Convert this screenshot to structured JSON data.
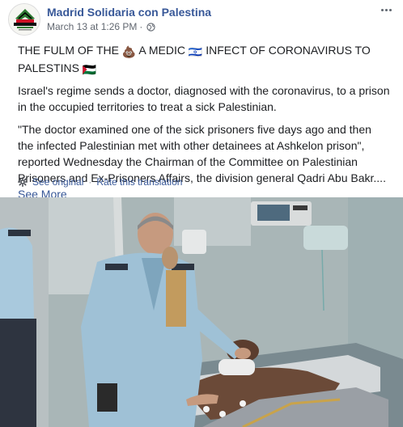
{
  "post": {
    "page_name": "Madrid Solidaria con Palestina",
    "timestamp": "March 13 at 1:26 PM",
    "separator": "·",
    "avatar_logo_text": "MADRID SOLIDARIA CON PALESTINA",
    "headline_part1": "THE FULM OF THE ",
    "headline_emoji1": "💩",
    "headline_part2": " A MEDIC ",
    "headline_emoji2": "🇮🇱",
    "headline_part3": " INFECT OF CORONAVIRUS TO PALESTINS ",
    "headline_emoji3": "🇵🇸",
    "paragraph1": "Israel's regime sends a doctor, diagnosed with the coronavirus, to a prison in the occupied territories to treat a sick Palestinian.",
    "paragraph2": "\"The doctor examined one of the sick prisoners five days ago and then the infected Palestinian met with other detainees at Ashkelon prison\", reported Wednesday the Chairman of the Committee on Palestinian Prisoners and Ex-Prisoners Affairs, the division general Qadri Abu Bakr....",
    "see_more": "See More",
    "see_original": "See original",
    "translate_sep": "·",
    "rate_translation": "Rate this translation"
  },
  "colors": {
    "link": "#385898",
    "text": "#1c1e21",
    "meta": "#616770"
  },
  "icons": [
    "globe-icon",
    "more-options-icon",
    "gear-icon"
  ]
}
